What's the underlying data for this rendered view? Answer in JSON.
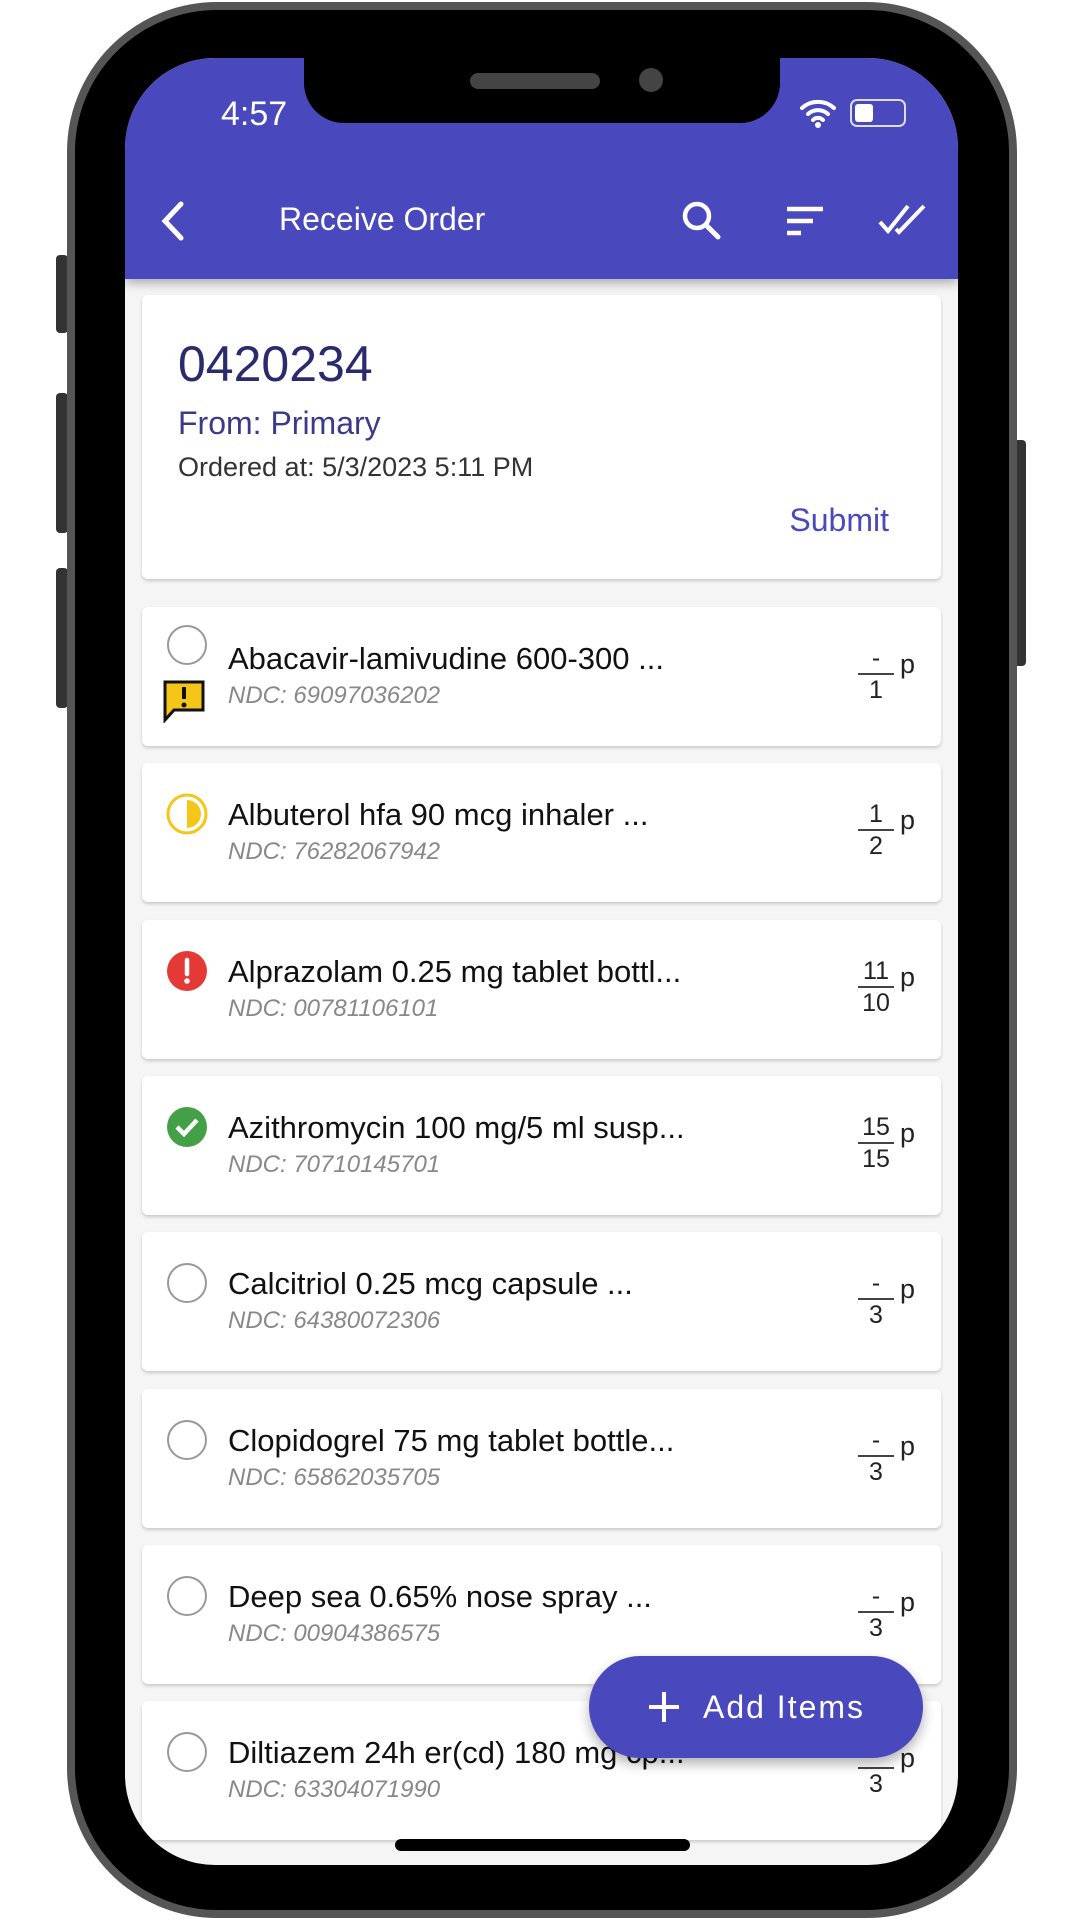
{
  "status_bar": {
    "time": "4:57"
  },
  "header": {
    "title": "Receive Order",
    "icons": [
      "back-icon",
      "search-icon",
      "sort-icon",
      "double-check-icon"
    ]
  },
  "order": {
    "number": "0420234",
    "from": "From: Primary",
    "ordered_at": "Ordered at: 5/3/2023 5:11 PM",
    "submit_label": "Submit"
  },
  "items": [
    {
      "name": "Abacavir-lamivudine 600-300 ...",
      "ndc": "NDC: 69097036202",
      "received": "-",
      "ordered": "1",
      "unit": "p",
      "status": "empty",
      "flag": "warning-comment"
    },
    {
      "name": "Albuterol hfa 90 mcg inhaler ...",
      "ndc": "NDC: 76282067942",
      "received": "1",
      "ordered": "2",
      "unit": "p",
      "status": "partial"
    },
    {
      "name": "Alprazolam 0.25 mg tablet bottl...",
      "ndc": "NDC: 00781106101",
      "received": "11",
      "ordered": "10",
      "unit": "p",
      "status": "error"
    },
    {
      "name": "Azithromycin 100 mg/5 ml susp...",
      "ndc": "NDC: 70710145701",
      "received": "15",
      "ordered": "15",
      "unit": "p",
      "status": "complete"
    },
    {
      "name": "Calcitriol 0.25 mcg capsule ...",
      "ndc": "NDC: 64380072306",
      "received": "-",
      "ordered": "3",
      "unit": "p",
      "status": "empty"
    },
    {
      "name": "Clopidogrel 75 mg tablet bottle...",
      "ndc": "NDC: 65862035705",
      "received": "-",
      "ordered": "3",
      "unit": "p",
      "status": "empty"
    },
    {
      "name": "Deep sea 0.65% nose spray ...",
      "ndc": "NDC: 00904386575",
      "received": "-",
      "ordered": "3",
      "unit": "p",
      "status": "empty"
    },
    {
      "name": "Diltiazem 24h er(cd) 180 mg cp...",
      "ndc": "NDC: 63304071990",
      "received": "-",
      "ordered": "3",
      "unit": "p",
      "status": "empty"
    }
  ],
  "fab": {
    "label": "Add Items",
    "icon": "plus-icon"
  },
  "colors": {
    "primary": "#4949bd",
    "warning": "#f5c518",
    "error": "#e53935",
    "success": "#43a047"
  }
}
